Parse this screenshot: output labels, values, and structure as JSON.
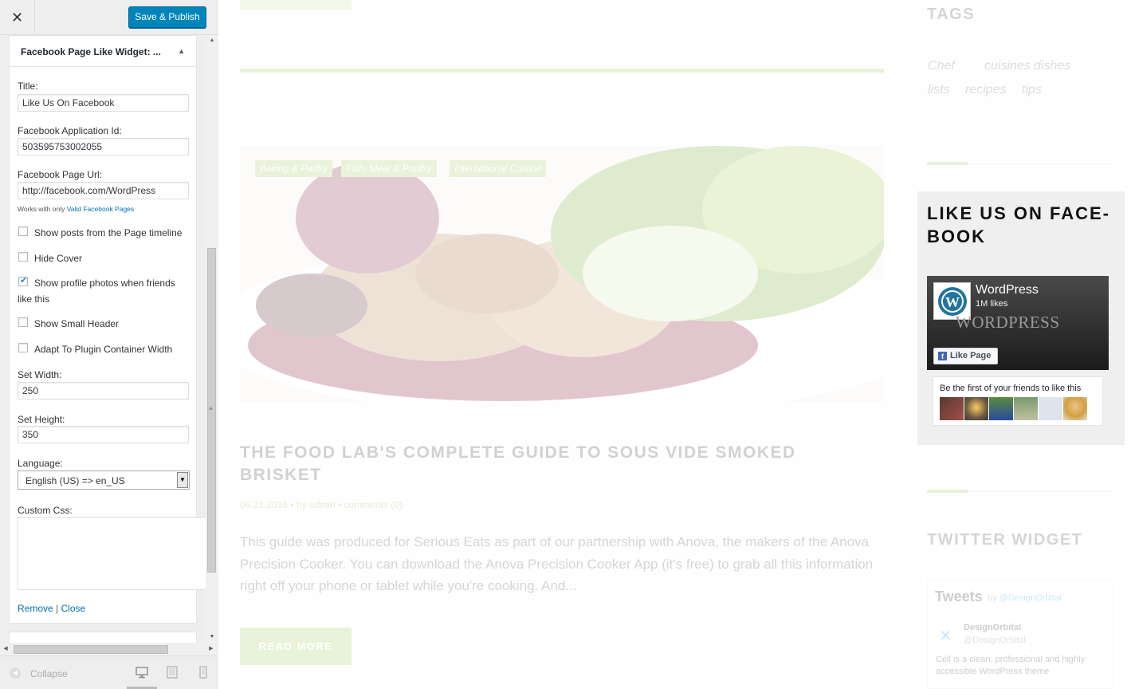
{
  "sidebar": {
    "close_symbol": "✕",
    "save_label": "Save & Publish",
    "widget": {
      "title": "Facebook Page Like Widget: ...",
      "toggle_symbol": "▲",
      "fields": {
        "title_label": "Title:",
        "title_value": "Like Us On Facebook",
        "appid_label": "Facebook Application Id:",
        "appid_value": "503595753002055",
        "pageurl_label": "Facebook Page Url:",
        "pageurl_value": "http://facebook.com/WordPress",
        "pageurl_note": "Works with only ",
        "pageurl_note_link": "Valid Facebook Pages"
      },
      "checkboxes": [
        {
          "label": "Show posts from the Page timeline",
          "checked": false
        },
        {
          "label": "Hide Cover",
          "checked": false
        },
        {
          "label": "Show profile photos when friends like this",
          "checked": true
        },
        {
          "label": "Show Small Header",
          "checked": false
        },
        {
          "label": "Adapt To Plugin Container Width",
          "checked": false
        }
      ],
      "width_label": "Set Width:",
      "width_value": "250",
      "height_label": "Set Height:",
      "height_value": "350",
      "language_label": "Language:",
      "language_value": "English (US) => en_US",
      "css_label": "Custom Css:",
      "remove_label": "Remove",
      "separator": " | ",
      "close_label": "Close"
    },
    "footer": {
      "collapse_label": "Collapse"
    }
  },
  "preview": {
    "post": {
      "categories": [
        "Baking & Pastry",
        "Fish, Meat & Poultry",
        "International Cuisine"
      ],
      "title": "The Food Lab's Complete Guide to Sous Vide Smoked Brisket",
      "date": "04.21.2016",
      "author": "by admin",
      "comments": "comments (0)",
      "meta_bullet": "•",
      "excerpt": "This guide was produced for Serious Eats as part of our partnership with Anova, the makers of the Anova Precision Cooker. You can download the Anova Precision Cooker App (it's free) to grab all this in­formation right off your phone or tablet while you're cooking. And...",
      "read_more": "READ MORE"
    },
    "tags": {
      "title": "TAGS",
      "items": [
        "Chef",
        "cuisines",
        "dishes",
        "lists",
        "recipes",
        "tips"
      ]
    },
    "facebook_widget": {
      "title": "LIKE US ON FACE-BOOK",
      "page_name": "WordPress",
      "likes": "1M likes",
      "wordmark": "WORDPRESS",
      "like_button": "Like Page",
      "friends_text": "Be the first of your friends to like this"
    },
    "twitter_widget": {
      "title": "TWITTER WIDGET",
      "heading": "Tweets",
      "by_prefix": "by ",
      "by_handle": "@DesignOrbital",
      "name": "DesignOrbital",
      "handle": "@DesignOrbital",
      "text": "Cell is a clean, professional and highly accessible WordPress theme"
    }
  },
  "colors": {
    "accent_green": "#a6cf6a",
    "save_blue": "#0085ba",
    "link_blue": "#0073aa",
    "facebook_blue": "#4267b2"
  }
}
